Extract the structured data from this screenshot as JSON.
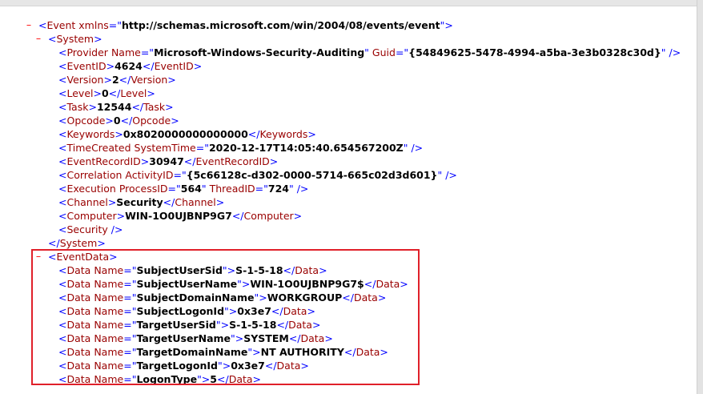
{
  "toggle_symbol": "–",
  "event": {
    "tag": "Event",
    "xmlns_attr": "xmlns",
    "xmlns_value": "http://schemas.microsoft.com/win/2004/08/events/event"
  },
  "system": {
    "tag": "System",
    "provider": {
      "tag": "Provider",
      "name_attr": "Name",
      "name": "Microsoft-Windows-Security-Auditing",
      "guid_attr": "Guid",
      "guid": "{54849625-5478-4994-a5ba-3e3b0328c30d}"
    },
    "event_id": {
      "tag": "EventID",
      "value": "4624"
    },
    "version": {
      "tag": "Version",
      "value": "2"
    },
    "level": {
      "tag": "Level",
      "value": "0"
    },
    "task": {
      "tag": "Task",
      "value": "12544"
    },
    "opcode": {
      "tag": "Opcode",
      "value": "0"
    },
    "keywords": {
      "tag": "Keywords",
      "value": "0x8020000000000000"
    },
    "time_created": {
      "tag": "TimeCreated",
      "attr": "SystemTime",
      "value": "2020-12-17T14:05:40.654567200Z"
    },
    "event_record_id": {
      "tag": "EventRecordID",
      "value": "30947"
    },
    "correlation": {
      "tag": "Correlation",
      "attr": "ActivityID",
      "value": "{5c66128c-d302-0000-5714-665c02d3d601}"
    },
    "execution": {
      "tag": "Execution",
      "pid_attr": "ProcessID",
      "pid": "564",
      "tid_attr": "ThreadID",
      "tid": "724"
    },
    "channel": {
      "tag": "Channel",
      "value": "Security"
    },
    "computer": {
      "tag": "Computer",
      "value": "WIN-1O0UJBNP9G7"
    },
    "security": {
      "tag": "Security"
    }
  },
  "event_data": {
    "tag": "EventData",
    "data_tag": "Data",
    "name_attr": "Name",
    "items": [
      {
        "name": "SubjectUserSid",
        "value": "S-1-5-18"
      },
      {
        "name": "SubjectUserName",
        "value": "WIN-1O0UJBNP9G7$"
      },
      {
        "name": "SubjectDomainName",
        "value": "WORKGROUP"
      },
      {
        "name": "SubjectLogonId",
        "value": "0x3e7"
      },
      {
        "name": "TargetUserSid",
        "value": "S-1-5-18"
      },
      {
        "name": "TargetUserName",
        "value": "SYSTEM"
      },
      {
        "name": "TargetDomainName",
        "value": "NT AUTHORITY"
      },
      {
        "name": "TargetLogonId",
        "value": "0x3e7"
      },
      {
        "name": "LogonType",
        "value": "5"
      }
    ]
  },
  "colors": {
    "markup": "#0000ff",
    "tag_name": "#990000",
    "value": "#000000",
    "toggle": "#ff0000",
    "highlight_border": "#e0202a"
  }
}
